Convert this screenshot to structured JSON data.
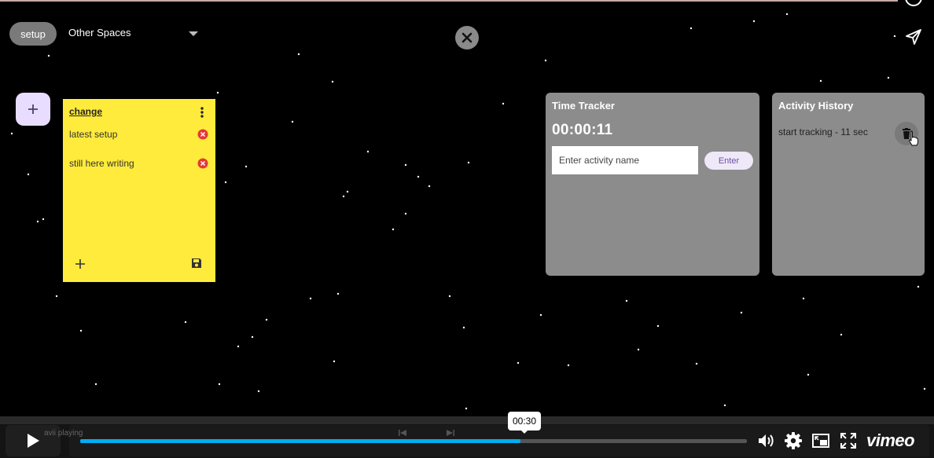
{
  "toolbar": {
    "space_chip_label": "setup",
    "space_select_value": "Other Spaces"
  },
  "note": {
    "title": "change",
    "items": [
      {
        "text": "latest setup"
      },
      {
        "text": "still here writing"
      }
    ],
    "color": "#ffeb3b"
  },
  "time_tracker": {
    "title": "Time Tracker",
    "elapsed": "00:00:11",
    "input_placeholder": "Enter activity name",
    "enter_label": "Enter"
  },
  "activity_history": {
    "title": "Activity History",
    "entries": [
      {
        "text": "start tracking - 11 sec"
      }
    ]
  },
  "video_player": {
    "behind_text": "avii playing",
    "progress_fraction": 0.66,
    "current_time": "00:30",
    "brand": "vimeo",
    "accent_color": "#00adef"
  },
  "icons": {
    "close": "close-icon",
    "send": "send-icon",
    "add": "plus-icon",
    "menu": "more-vert-icon",
    "remove": "remove-circle-icon",
    "save": "save-icon",
    "delete": "trash-icon"
  }
}
